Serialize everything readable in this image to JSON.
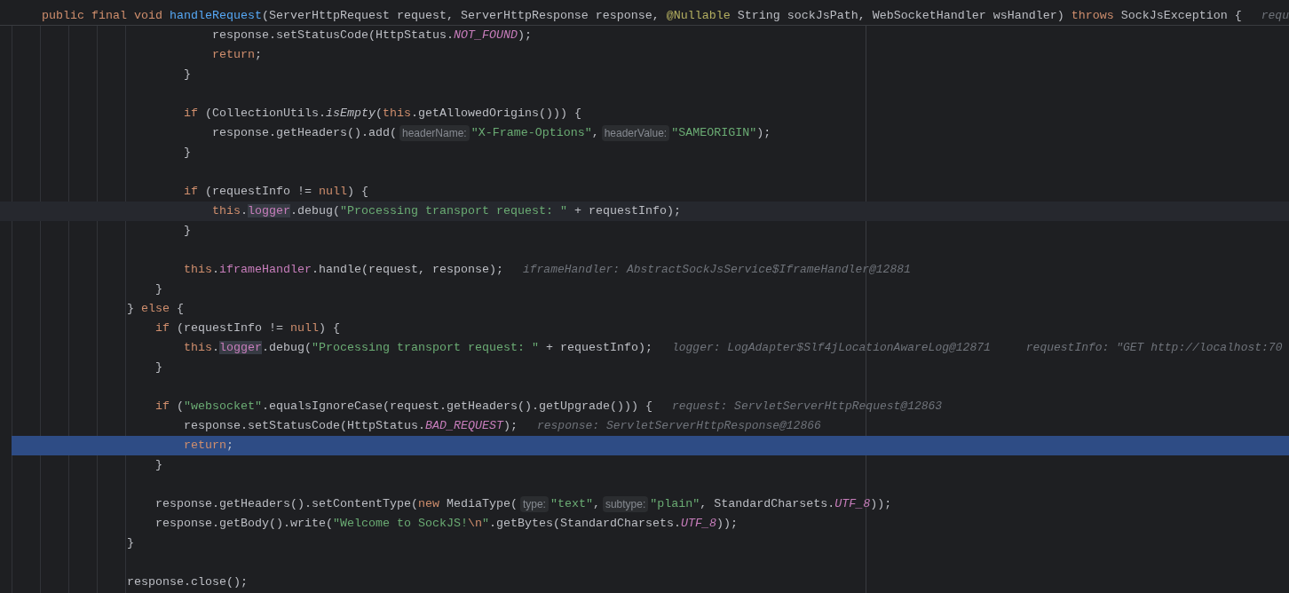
{
  "sticky_header": {
    "parts": [
      {
        "kind": "code",
        "tokens": [
          {
            "text": "public final void ",
            "kind": "keyword"
          },
          {
            "text": "handleRequest",
            "kind": "decl"
          },
          {
            "text": "(ServerHttpRequest request, ServerHttpResponse response, ",
            "kind": "plain"
          },
          {
            "text": "@Nullable",
            "kind": "annotation"
          },
          {
            "text": " String sockJsPath, WebSocketHandler wsHandler) ",
            "kind": "plain"
          },
          {
            "text": "throws",
            "kind": "keyword"
          },
          {
            "text": " SockJsException {",
            "kind": "plain"
          }
        ]
      },
      {
        "kind": "value",
        "text": "requ"
      }
    ]
  },
  "lines": [
    {
      "children": [
        {
          "children": [
            {
              "children": [
                {
                  "caret_line": false,
                  "execution_point": false,
                  "parts": [
                    {
                      "kind": "code",
                      "tokens": [
                        {
                          "text": "response.setStatusCode(HttpStatus.",
                          "kind": "plain"
                        },
                        {
                          "text": "NOT_FOUND",
                          "kind": "constant"
                        },
                        {
                          "text": ");",
                          "kind": "plain"
                        }
                      ]
                    }
                  ]
                },
                {
                  "caret_line": false,
                  "execution_point": false,
                  "parts": [
                    {
                      "kind": "code",
                      "tokens": [
                        {
                          "text": "return",
                          "kind": "keyword"
                        },
                        {
                          "text": ";",
                          "kind": "plain"
                        }
                      ]
                    }
                  ]
                }
              ]
            },
            {
              "caret_line": false,
              "execution_point": false,
              "parts": [
                {
                  "kind": "code",
                  "tokens": [
                    {
                      "text": "}",
                      "kind": "plain"
                    }
                  ]
                }
              ]
            },
            {
              "caret_line": false,
              "execution_point": false
            },
            {
              "caret_line": false,
              "execution_point": false,
              "parts": [
                {
                  "kind": "code",
                  "tokens": [
                    {
                      "text": "if",
                      "kind": "keyword"
                    },
                    {
                      "text": " (CollectionUtils.",
                      "kind": "plain"
                    },
                    {
                      "text": "isEmpty",
                      "kind": "static"
                    },
                    {
                      "text": "(",
                      "kind": "plain"
                    },
                    {
                      "text": "this",
                      "kind": "keyword"
                    },
                    {
                      "text": ".getAllowedOrigins())) {",
                      "kind": "plain"
                    }
                  ]
                }
              ],
              "children": [
                {
                  "caret_line": false,
                  "execution_point": false,
                  "parts": [
                    {
                      "kind": "code",
                      "tokens": [
                        {
                          "text": "response.getHeaders().add(",
                          "kind": "plain"
                        }
                      ]
                    },
                    {
                      "kind": "hint",
                      "text": "headerName:"
                    },
                    {
                      "kind": "code",
                      "tokens": [
                        {
                          "text": "\"X-Frame-Options\"",
                          "kind": "string"
                        },
                        {
                          "text": ",",
                          "kind": "plain"
                        }
                      ]
                    },
                    {
                      "kind": "hint",
                      "text": "headerValue:"
                    },
                    {
                      "kind": "code",
                      "tokens": [
                        {
                          "text": "\"SAMEORIGIN\"",
                          "kind": "string"
                        },
                        {
                          "text": ");",
                          "kind": "plain"
                        }
                      ]
                    }
                  ]
                }
              ]
            },
            {
              "caret_line": false,
              "execution_point": false,
              "parts": [
                {
                  "kind": "code",
                  "tokens": [
                    {
                      "text": "}",
                      "kind": "plain"
                    }
                  ]
                }
              ]
            },
            {
              "caret_line": false,
              "execution_point": false
            },
            {
              "caret_line": false,
              "execution_point": false,
              "parts": [
                {
                  "kind": "code",
                  "tokens": [
                    {
                      "text": "if",
                      "kind": "keyword"
                    },
                    {
                      "text": " (requestInfo != ",
                      "kind": "plain"
                    },
                    {
                      "text": "null",
                      "kind": "keyword"
                    },
                    {
                      "text": ") {",
                      "kind": "plain"
                    }
                  ]
                }
              ],
              "children": [
                {
                  "caret_line": true,
                  "execution_point": false,
                  "parts": [
                    {
                      "kind": "code",
                      "tokens": [
                        {
                          "text": "this",
                          "kind": "keyword"
                        },
                        {
                          "text": ".",
                          "kind": "plain"
                        },
                        {
                          "text": "logger",
                          "kind": "field-usage"
                        },
                        {
                          "text": ".debug(",
                          "kind": "plain"
                        },
                        {
                          "text": "\"Processing transport request: \"",
                          "kind": "string"
                        },
                        {
                          "text": " + requestInfo);",
                          "kind": "plain"
                        }
                      ]
                    }
                  ]
                }
              ]
            },
            {
              "caret_line": false,
              "execution_point": false,
              "parts": [
                {
                  "kind": "code",
                  "tokens": [
                    {
                      "text": "}",
                      "kind": "plain"
                    }
                  ]
                }
              ]
            },
            {
              "caret_line": false,
              "execution_point": false
            },
            {
              "caret_line": false,
              "execution_point": false,
              "parts": [
                {
                  "kind": "code",
                  "tokens": [
                    {
                      "text": "this",
                      "kind": "keyword"
                    },
                    {
                      "text": ".",
                      "kind": "plain"
                    },
                    {
                      "text": "iframeHandler",
                      "kind": "field"
                    },
                    {
                      "text": ".handle(request, response);",
                      "kind": "plain"
                    }
                  ]
                },
                {
                  "kind": "value",
                  "text": "iframeHandler: AbstractSockJsService$IframeHandler@12881"
                }
              ]
            }
          ]
        },
        {
          "caret_line": false,
          "execution_point": false,
          "parts": [
            {
              "kind": "code",
              "tokens": [
                {
                  "text": "}",
                  "kind": "plain"
                }
              ]
            }
          ]
        }
      ]
    },
    {
      "caret_line": false,
      "execution_point": false,
      "parts": [
        {
          "kind": "code",
          "tokens": [
            {
              "text": "} ",
              "kind": "plain"
            },
            {
              "text": "else",
              "kind": "keyword"
            },
            {
              "text": " {",
              "kind": "plain"
            }
          ]
        }
      ],
      "children": [
        {
          "caret_line": false,
          "execution_point": false,
          "parts": [
            {
              "kind": "code",
              "tokens": [
                {
                  "text": "if",
                  "kind": "keyword"
                },
                {
                  "text": " (requestInfo != ",
                  "kind": "plain"
                },
                {
                  "text": "null",
                  "kind": "keyword"
                },
                {
                  "text": ") {",
                  "kind": "plain"
                }
              ]
            }
          ],
          "children": [
            {
              "caret_line": false,
              "execution_point": false,
              "parts": [
                {
                  "kind": "code",
                  "tokens": [
                    {
                      "text": "this",
                      "kind": "keyword"
                    },
                    {
                      "text": ".",
                      "kind": "plain"
                    },
                    {
                      "text": "logger",
                      "kind": "field-usage"
                    },
                    {
                      "text": ".debug(",
                      "kind": "plain"
                    },
                    {
                      "text": "\"Processing transport request: \"",
                      "kind": "string"
                    },
                    {
                      "text": " + requestInfo);",
                      "kind": "plain"
                    }
                  ]
                },
                {
                  "kind": "value",
                  "text": "logger: LogAdapter$Slf4jLocationAwareLog@12871"
                },
                {
                  "kind": "value",
                  "text": "requestInfo: \"GET http://localhost:70"
                }
              ]
            }
          ]
        },
        {
          "caret_line": false,
          "execution_point": false,
          "parts": [
            {
              "kind": "code",
              "tokens": [
                {
                  "text": "}",
                  "kind": "plain"
                }
              ]
            }
          ]
        },
        {
          "caret_line": false,
          "execution_point": false
        },
        {
          "caret_line": false,
          "execution_point": false,
          "parts": [
            {
              "kind": "code",
              "tokens": [
                {
                  "text": "if",
                  "kind": "keyword"
                },
                {
                  "text": " (",
                  "kind": "plain"
                },
                {
                  "text": "\"websocket\"",
                  "kind": "string"
                },
                {
                  "text": ".equalsIgnoreCase(request.getHeaders().getUpgrade())) {",
                  "kind": "plain"
                }
              ]
            },
            {
              "kind": "value",
              "text": "request: ServletServerHttpRequest@12863"
            }
          ],
          "children": [
            {
              "caret_line": false,
              "execution_point": false,
              "parts": [
                {
                  "kind": "code",
                  "tokens": [
                    {
                      "text": "response.setStatusCode(HttpStatus.",
                      "kind": "plain"
                    },
                    {
                      "text": "BAD_REQUEST",
                      "kind": "constant"
                    },
                    {
                      "text": ");",
                      "kind": "plain"
                    }
                  ]
                },
                {
                  "kind": "value",
                  "text": "response: ServletServerHttpResponse@12866"
                }
              ]
            },
            {
              "caret_line": false,
              "execution_point": true,
              "parts": [
                {
                  "kind": "code",
                  "tokens": [
                    {
                      "text": "return",
                      "kind": "keyword"
                    },
                    {
                      "text": ";",
                      "kind": "plain"
                    }
                  ]
                }
              ]
            }
          ]
        },
        {
          "caret_line": false,
          "execution_point": false,
          "parts": [
            {
              "kind": "code",
              "tokens": [
                {
                  "text": "}",
                  "kind": "plain"
                }
              ]
            }
          ]
        },
        {
          "caret_line": false,
          "execution_point": false
        },
        {
          "caret_line": false,
          "execution_point": false,
          "parts": [
            {
              "kind": "code",
              "tokens": [
                {
                  "text": "response.getHeaders().setContentType(",
                  "kind": "plain"
                },
                {
                  "text": "new",
                  "kind": "keyword"
                },
                {
                  "text": " MediaType(",
                  "kind": "plain"
                }
              ]
            },
            {
              "kind": "hint",
              "text": "type:"
            },
            {
              "kind": "code",
              "tokens": [
                {
                  "text": "\"text\"",
                  "kind": "string"
                },
                {
                  "text": ",",
                  "kind": "plain"
                }
              ]
            },
            {
              "kind": "hint",
              "text": "subtype:"
            },
            {
              "kind": "code",
              "tokens": [
                {
                  "text": "\"plain\"",
                  "kind": "string"
                },
                {
                  "text": ", StandardCharsets.",
                  "kind": "plain"
                },
                {
                  "text": "UTF_8",
                  "kind": "constant"
                },
                {
                  "text": "));",
                  "kind": "plain"
                }
              ]
            }
          ]
        },
        {
          "caret_line": false,
          "execution_point": false,
          "parts": [
            {
              "kind": "code",
              "tokens": [
                {
                  "text": "response.getBody().write(",
                  "kind": "plain"
                },
                {
                  "text": "\"Welcome to SockJS!",
                  "kind": "string"
                },
                {
                  "text": "\\n",
                  "kind": "escape"
                },
                {
                  "text": "\"",
                  "kind": "string"
                },
                {
                  "text": ".getBytes(StandardCharsets.",
                  "kind": "plain"
                },
                {
                  "text": "UTF_8",
                  "kind": "constant"
                },
                {
                  "text": "));",
                  "kind": "plain"
                }
              ]
            }
          ]
        }
      ]
    },
    {
      "caret_line": false,
      "execution_point": false,
      "parts": [
        {
          "kind": "code",
          "tokens": [
            {
              "text": "}",
              "kind": "plain"
            }
          ]
        }
      ]
    },
    {
      "caret_line": false,
      "execution_point": false
    },
    {
      "caret_line": false,
      "execution_point": false,
      "parts": [
        {
          "kind": "code",
          "tokens": [
            {
              "text": "response.close();",
              "kind": "plain"
            }
          ]
        }
      ]
    }
  ]
}
